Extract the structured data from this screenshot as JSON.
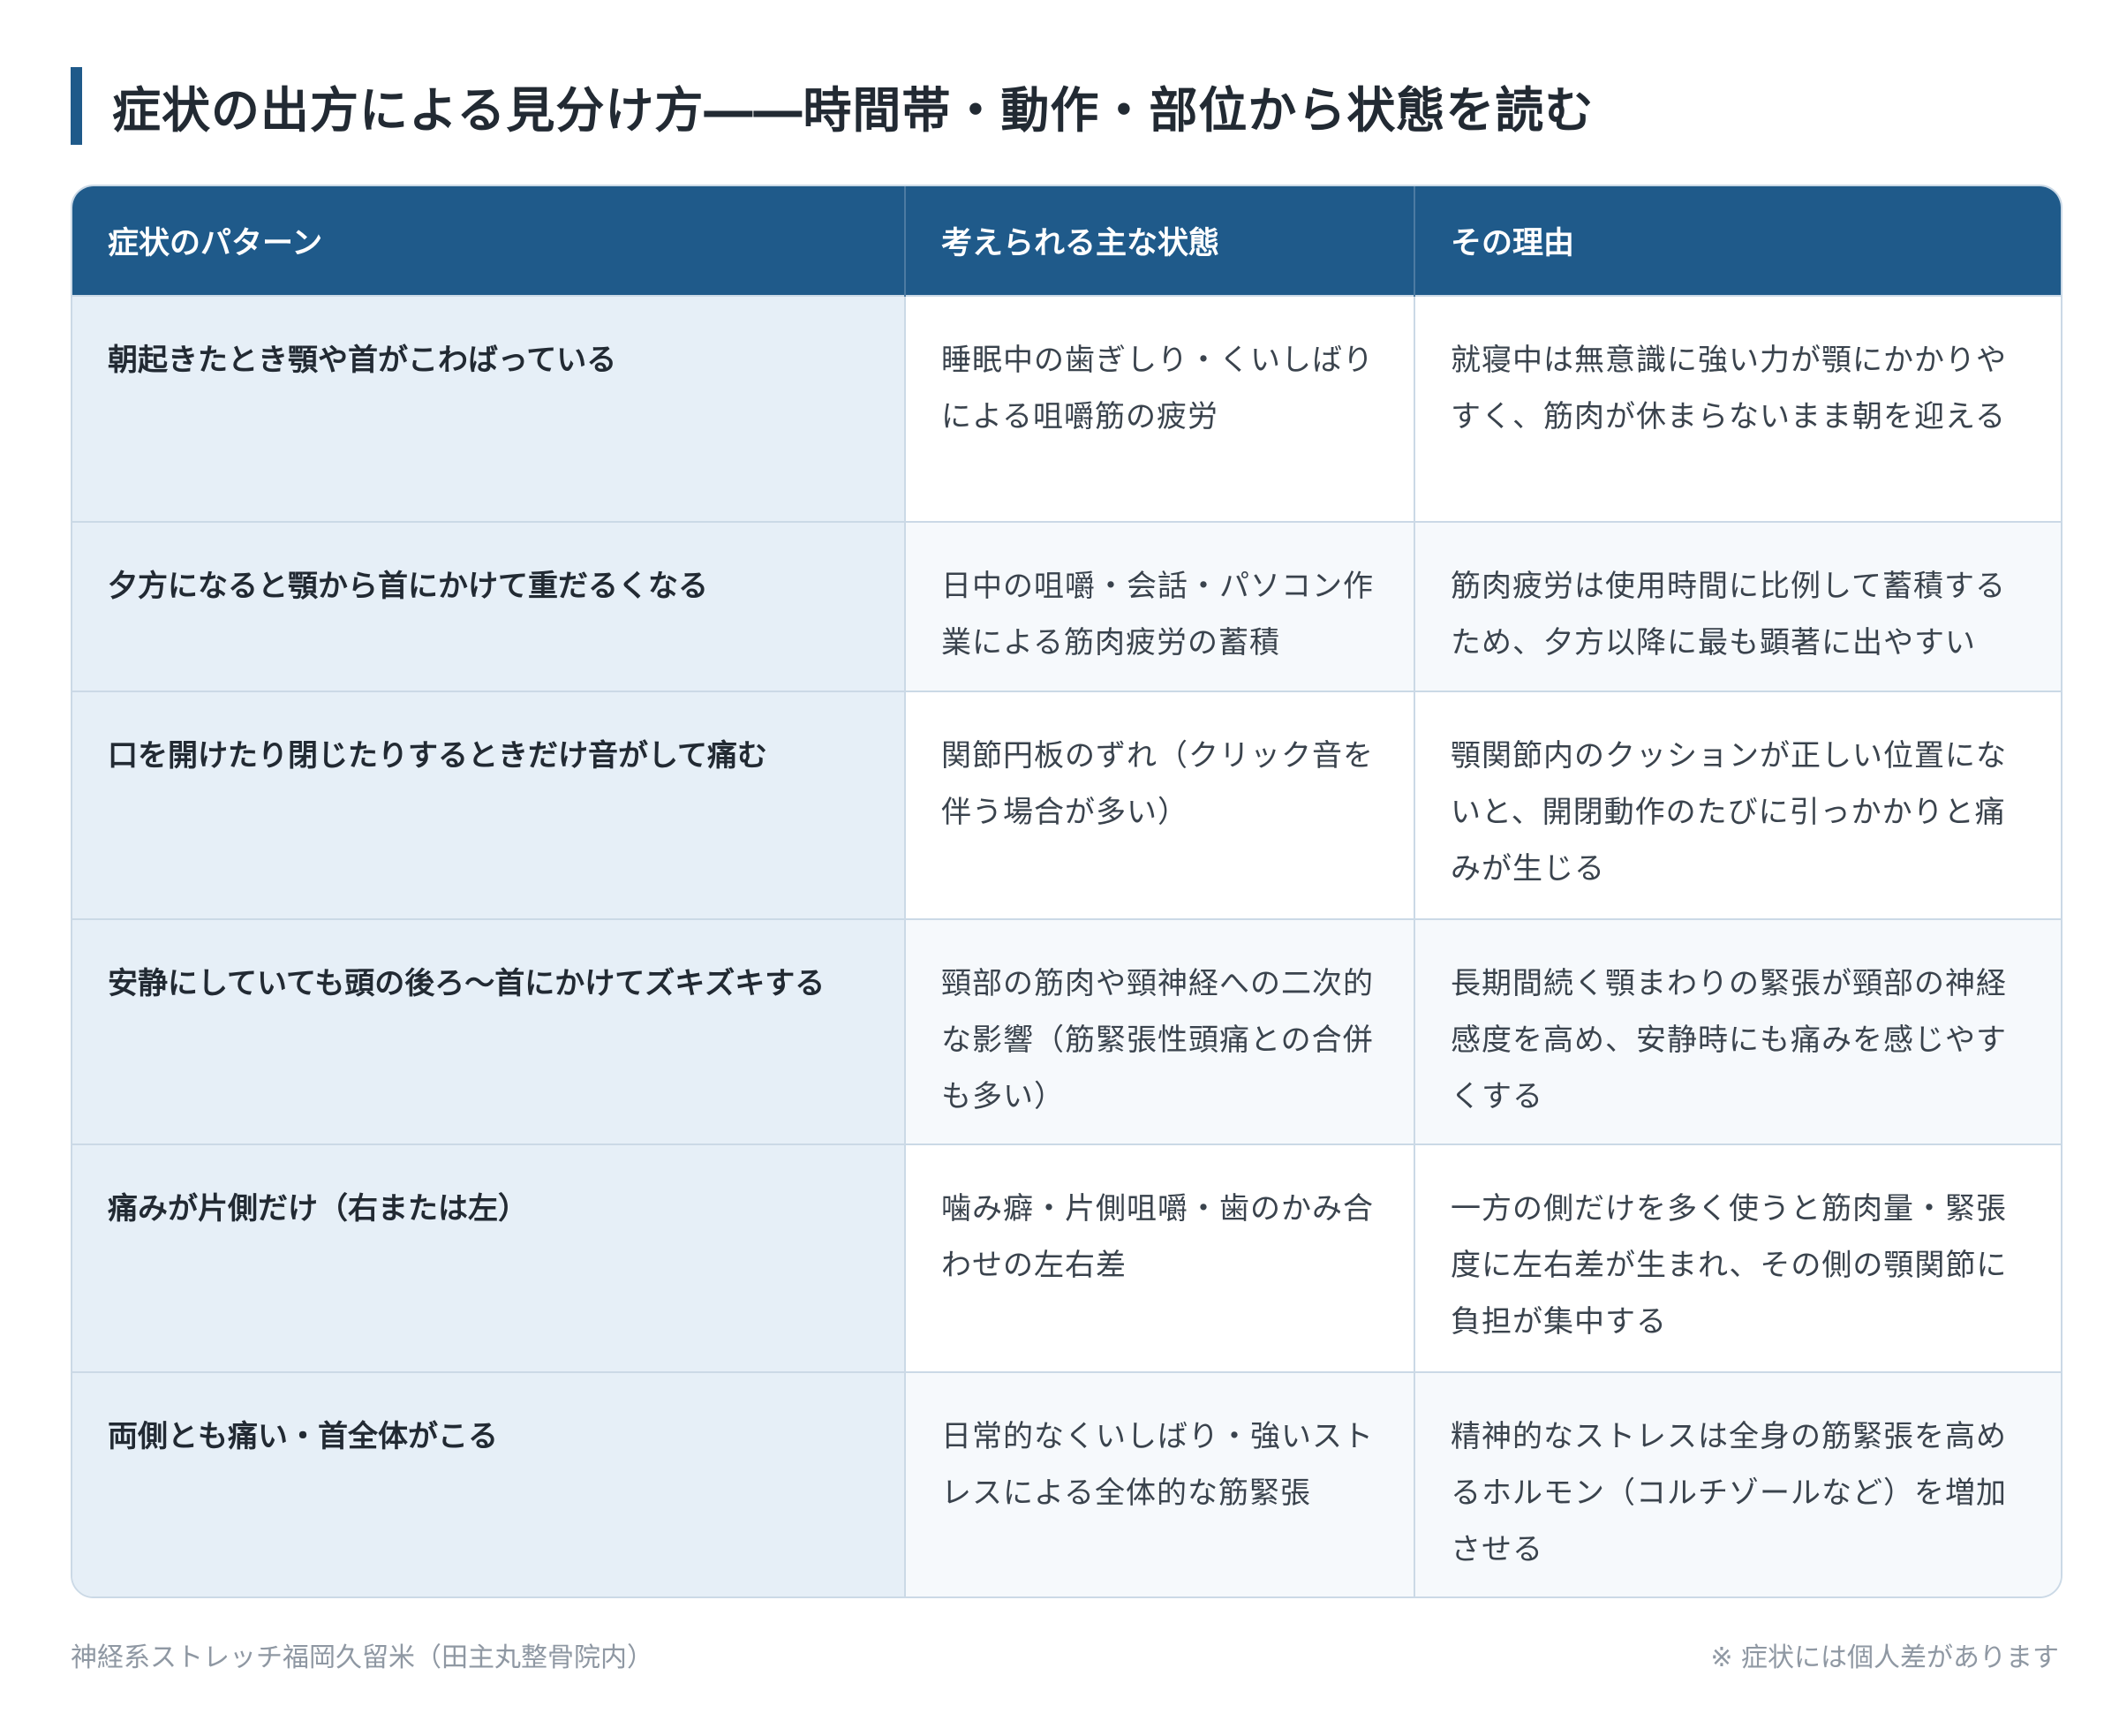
{
  "title": "症状の出方による見分け方――時間帯・動作・部位から状態を読む",
  "table": {
    "headers": [
      "症状のパターン",
      "考えられる主な状態",
      "その理由"
    ],
    "rows": [
      {
        "pattern": "朝起きたとき顎や首がこわばっている",
        "state": "睡眠中の歯ぎしり・くいしばりによる咀嚼筋の疲労",
        "reason": "就寝中は無意識に強い力が顎にかかりやすく、筋肉が休まらないまま朝を迎える"
      },
      {
        "pattern": "夕方になると顎から首にかけて重だるくなる",
        "state": "日中の咀嚼・会話・パソコン作業による筋肉疲労の蓄積",
        "reason": "筋肉疲労は使用時間に比例して蓄積するため、夕方以降に最も顕著に出やすい"
      },
      {
        "pattern": "口を開けたり閉じたりするときだけ音がして痛む",
        "state": "関節円板のずれ（クリック音を伴う場合が多い）",
        "reason": "顎関節内のクッションが正しい位置にないと、開閉動作のたびに引っかかりと痛みが生じる"
      },
      {
        "pattern": "安静にしていても頭の後ろ〜首にかけてズキズキする",
        "state": "頸部の筋肉や頸神経への二次的な影響（筋緊張性頭痛との合併も多い）",
        "reason": "長期間続く顎まわりの緊張が頸部の神経感度を高め、安静時にも痛みを感じやすくする"
      },
      {
        "pattern": "痛みが片側だけ（右または左）",
        "state": "噛み癖・片側咀嚼・歯のかみ合わせの左右差",
        "reason": "一方の側だけを多く使うと筋肉量・緊張度に左右差が生まれ、その側の顎関節に負担が集中する"
      },
      {
        "pattern": "両側とも痛い・首全体がこる",
        "state": "日常的なくいしばり・強いストレスによる全体的な筋緊張",
        "reason": "精神的なストレスは全身の筋緊張を高めるホルモン（コルチゾールなど）を増加させる"
      }
    ]
  },
  "footer": {
    "source": "神経系ストレッチ福岡久留米（田主丸整骨院内）",
    "note": "※ 症状には個人差があります"
  },
  "colors": {
    "accent": "#1f5a8a",
    "first_column_bg": "#e6eff7",
    "border": "#cbd9e6"
  }
}
